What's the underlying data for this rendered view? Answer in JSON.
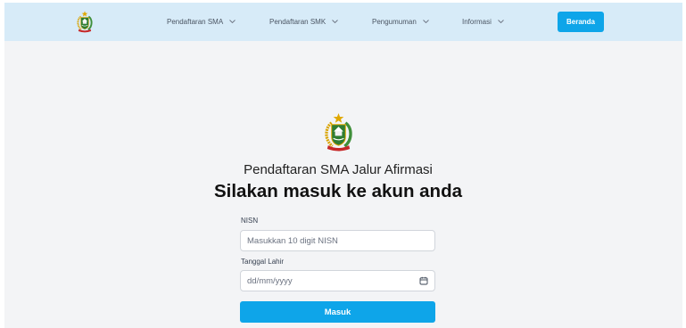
{
  "navbar": {
    "logo_icon": "provincial-emblem-icon",
    "menu": [
      {
        "label": "Pendaftaran SMA",
        "icon": "chevron-down-icon"
      },
      {
        "label": "Pendaftaran SMK",
        "icon": "chevron-down-icon"
      },
      {
        "label": "Pengumuman",
        "icon": "chevron-down-icon"
      },
      {
        "label": "Informasi",
        "icon": "chevron-down-icon"
      }
    ],
    "home_button": "Beranda"
  },
  "login": {
    "emblem_icon": "provincial-emblem-icon",
    "subtitle": "Pendaftaran SMA Jalur Afirmasi",
    "title": "Silakan masuk ke akun anda",
    "nisn": {
      "label": "NISN",
      "placeholder": "Masukkan 10 digit NISN"
    },
    "birth_date": {
      "label": "Tanggal Lahir",
      "placeholder": "dd/mm/yyyy",
      "icon": "calendar-icon"
    },
    "submit_button": "Masuk"
  },
  "colors": {
    "navbar_bg": "#d7ebf8",
    "page_bg": "#f3f4f6",
    "accent": "#0ea5e9",
    "text_dark": "#111111",
    "text_muted": "#6b7280",
    "input_border": "#d1d5db"
  }
}
